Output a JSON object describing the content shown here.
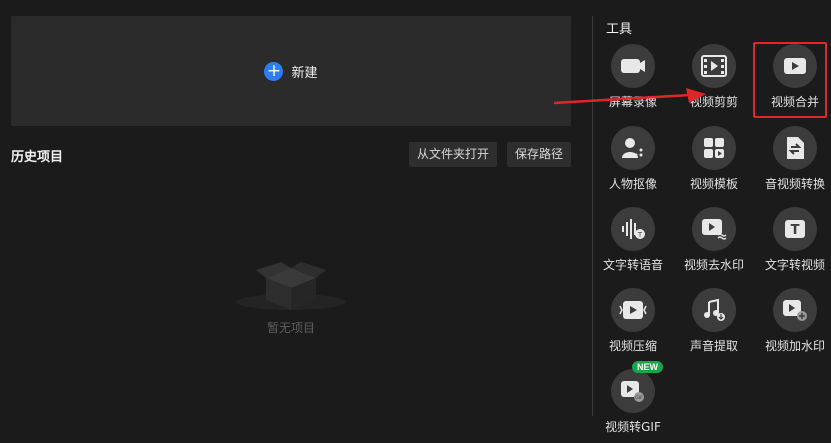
{
  "create": {
    "label": "新建",
    "icon": "plus-icon"
  },
  "history": {
    "title": "历史项目",
    "open_folder_label": "从文件夹打开",
    "save_path_label": "保存路径",
    "empty_text": "暂无项目"
  },
  "tools": {
    "title": "工具",
    "items": [
      {
        "label": "屏幕录像",
        "icon": "screen-record-icon"
      },
      {
        "label": "视频剪剪",
        "icon": "video-cut-icon"
      },
      {
        "label": "视频合并",
        "icon": "video-merge-icon"
      },
      {
        "label": "人物抠像",
        "icon": "portrait-cutout-icon"
      },
      {
        "label": "视频模板",
        "icon": "video-template-icon"
      },
      {
        "label": "音视频转换",
        "icon": "av-convert-icon"
      },
      {
        "label": "文字转语音",
        "icon": "text-to-speech-icon"
      },
      {
        "label": "视频去水印",
        "icon": "remove-watermark-icon"
      },
      {
        "label": "文字转视频",
        "icon": "text-to-video-icon"
      },
      {
        "label": "视频压缩",
        "icon": "video-compress-icon"
      },
      {
        "label": "声音提取",
        "icon": "audio-extract-icon"
      },
      {
        "label": "视频加水印",
        "icon": "add-watermark-icon"
      },
      {
        "label": "视频转GIF",
        "icon": "video-to-gif-icon",
        "badge": "NEW"
      }
    ]
  },
  "colors": {
    "accent": "#2f7df6",
    "highlight": "#e0262b",
    "new_badge": "#19a64a"
  }
}
